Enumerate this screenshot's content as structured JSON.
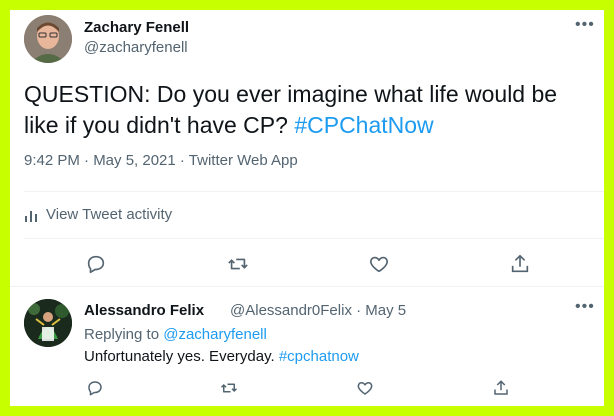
{
  "tweet": {
    "author_name": "Zachary Fenell",
    "author_handle": "@zacharyfenell",
    "text_prefix": "QUESTION: Do you ever imagine what life would be like if you didn't have CP?",
    "hashtag": "#CPChatNow",
    "timestamp": "9:42 PM · May 5, 2021 · Twitter Web App",
    "activity_label": "View Tweet activity"
  },
  "reply": {
    "author_name": "Alessandro Felix",
    "author_handle_and_date": "@Alessandr0Felix · May 5",
    "replying_to_label": "Replying to",
    "replying_to_handle": "@zacharyfenell",
    "text_prefix": "Unfortunately yes. Everyday.",
    "hashtag": "#cpchatnow"
  },
  "icons": {
    "more": "more-icon",
    "reply": "reply-icon",
    "retweet": "retweet-icon",
    "like": "like-icon",
    "share": "share-icon",
    "activity": "bar-chart-icon"
  },
  "colors": {
    "border": "#c8ff00",
    "link": "#1d9bf0",
    "muted": "#536471",
    "text": "#0f1419"
  }
}
